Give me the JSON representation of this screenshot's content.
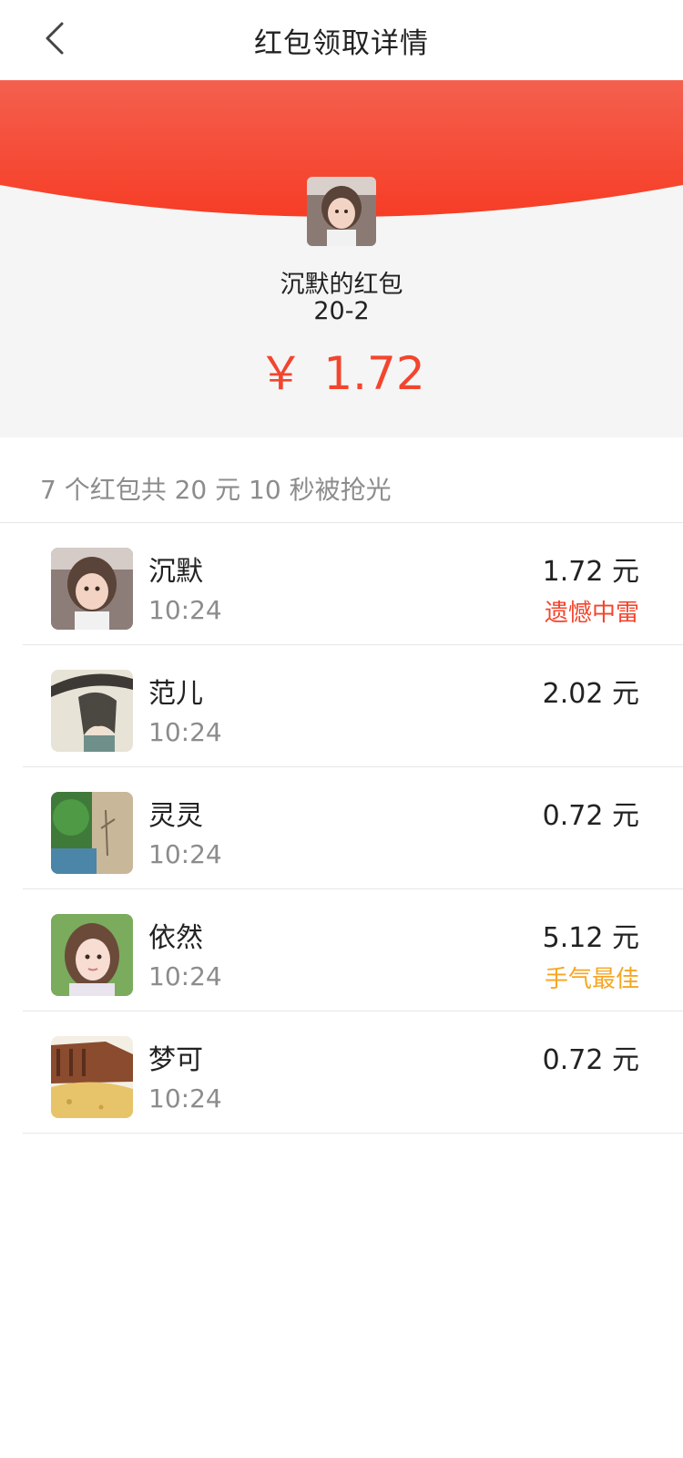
{
  "nav": {
    "title": "红包领取详情",
    "back_icon": "chevron-left-icon"
  },
  "hero": {
    "sender_name": "沉默的红包",
    "sender_sub": "20-2",
    "currency": "￥",
    "amount": "1.72",
    "accent_color": "#f3452e"
  },
  "summary": {
    "text": "7 个红包共 20 元 10 秒被抢光"
  },
  "records": [
    {
      "name": "沉默",
      "time": "10:24",
      "amount": "1.72 元",
      "badge": "遗憾中雷",
      "badge_color": "#f3452e"
    },
    {
      "name": "范儿",
      "time": "10:24",
      "amount": "2.02 元",
      "badge": "",
      "badge_color": ""
    },
    {
      "name": "灵灵",
      "time": "10:24",
      "amount": "0.72 元",
      "badge": "",
      "badge_color": ""
    },
    {
      "name": "依然",
      "time": "10:24",
      "amount": "5.12 元",
      "badge": "手气最佳",
      "badge_color": "#f5a623"
    },
    {
      "name": "梦可",
      "time": "10:24",
      "amount": "0.72 元",
      "badge": "",
      "badge_color": ""
    }
  ]
}
